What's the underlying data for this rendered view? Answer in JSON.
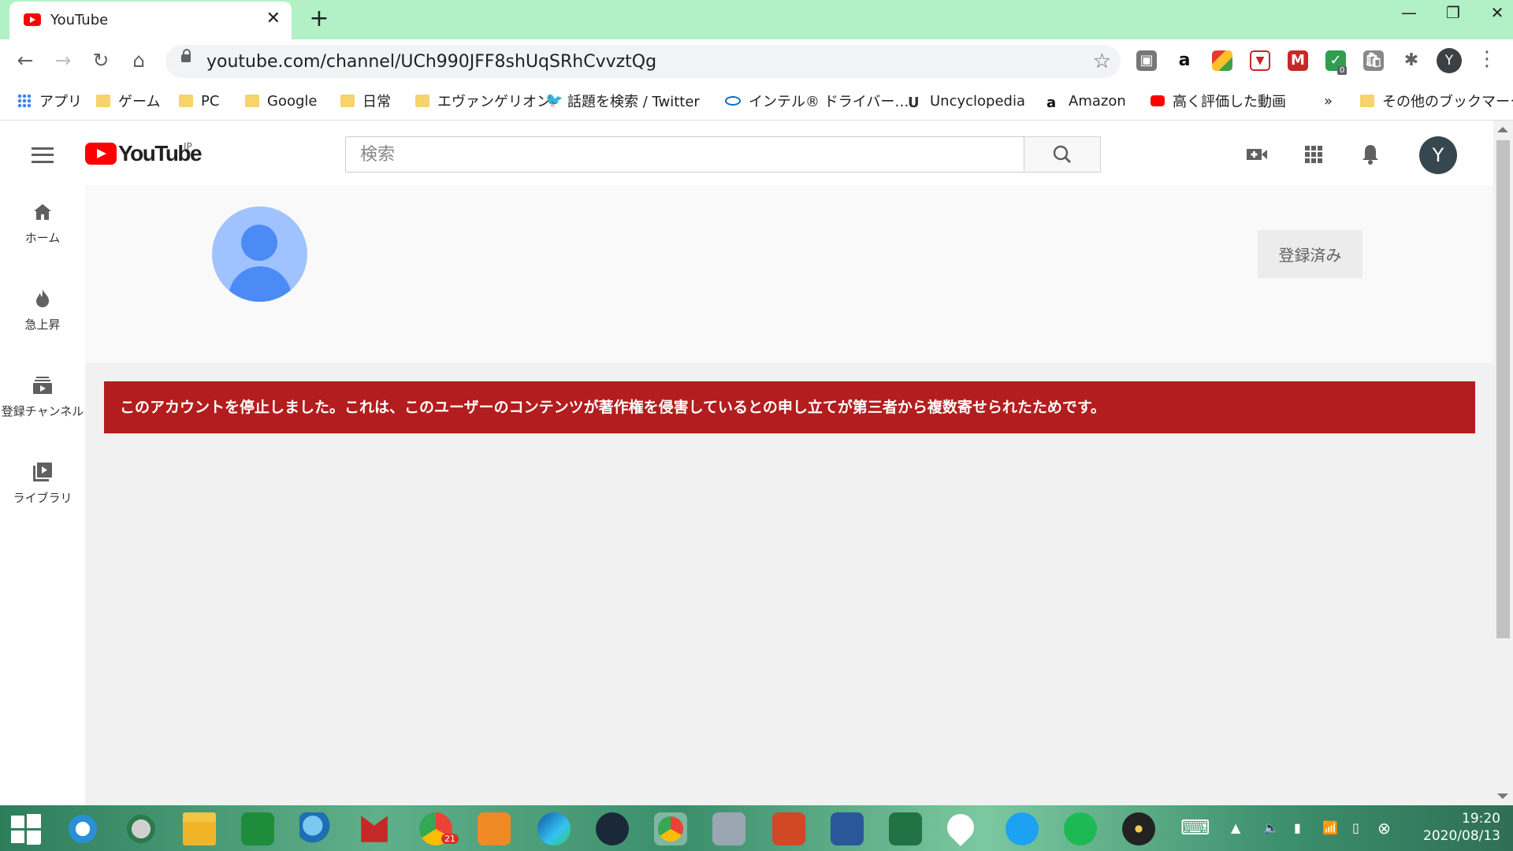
{
  "browser": {
    "tab_title": "YouTube",
    "url": "youtube.com/channel/UCh990JFF8shUqSRhCvvztQg",
    "profile_initial": "Y",
    "extension_badge": "0"
  },
  "bookmarks": {
    "items": [
      {
        "label": "アプリ",
        "icon": "apps-grid-icon"
      },
      {
        "label": "ゲーム",
        "icon": "folder-icon"
      },
      {
        "label": "PC",
        "icon": "folder-icon"
      },
      {
        "label": "Google",
        "icon": "folder-icon"
      },
      {
        "label": "日常",
        "icon": "folder-icon"
      },
      {
        "label": "エヴァンゲリオン",
        "icon": "folder-icon"
      },
      {
        "label": "話題を検索 / Twitter",
        "icon": "twitter-icon"
      },
      {
        "label": "インテル® ドライバー…",
        "icon": "intel-icon"
      },
      {
        "label": "Uncyclopedia",
        "icon": "uncyclopedia-icon"
      },
      {
        "label": "Amazon",
        "icon": "amazon-icon"
      },
      {
        "label": "高く評価した動画",
        "icon": "youtube-icon"
      }
    ],
    "overflow": "»",
    "other": "その他のブックマーク"
  },
  "youtube": {
    "logo_text": "YouTube",
    "region": "JP",
    "search_placeholder": "検索",
    "avatar_initial": "Y",
    "sidebar": [
      {
        "label": "ホーム",
        "icon": "home-icon"
      },
      {
        "label": "急上昇",
        "icon": "trending-icon"
      },
      {
        "label": "登録チャンネル",
        "icon": "subscriptions-icon"
      },
      {
        "label": "ライブラリ",
        "icon": "library-icon"
      }
    ],
    "subscribed_label": "登録済み",
    "termination_message": "このアカウントを停止しました。これは、このユーザーのコンテンツが著作権を侵害しているとの申し立てが第三者から複数寄せられたためです。"
  },
  "taskbar": {
    "time": "19:20",
    "date": "2020/08/13",
    "chrome_badge": "21"
  },
  "colors": {
    "tabstrip": "#b2f0c6",
    "alert_red": "#b31d1d",
    "youtube_red": "#ff0000"
  }
}
